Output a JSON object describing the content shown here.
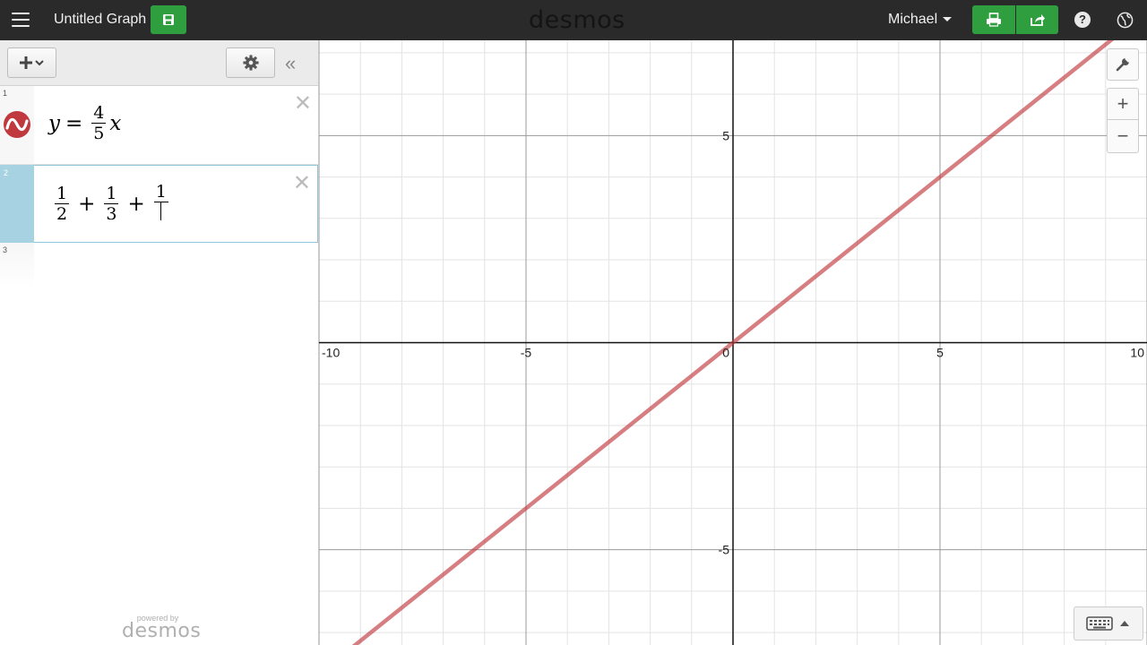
{
  "topbar": {
    "title": "Untitled Graph",
    "logo": "desmos",
    "user": "Michael",
    "help_label": "?",
    "icons": [
      "menu-icon",
      "save-icon",
      "print-icon",
      "share-icon",
      "help-icon",
      "globe-icon"
    ]
  },
  "panel": {
    "collapse_label": "«",
    "expressions": [
      {
        "index": "1",
        "latex": "y=\\frac{4}{5}x",
        "lhs": "y",
        "eq": "=",
        "num": "4",
        "den": "5",
        "var": "x",
        "color": "#c0393f"
      },
      {
        "index": "2",
        "latex": "\\frac{1}{2}+\\frac{1}{3}+\\frac{1}{}",
        "terms": [
          {
            "num": "1",
            "den": "2"
          },
          {
            "num": "1",
            "den": "3"
          },
          {
            "num": "1",
            "den": ""
          }
        ],
        "plus": "+"
      },
      {
        "index": "3"
      }
    ],
    "powered_by": "powered by",
    "powered_brand": "desmos"
  },
  "graph": {
    "zoom_in_label": "+",
    "zoom_out_label": "−",
    "x_ticks": [
      "-10",
      "-5",
      "0",
      "5",
      "10"
    ],
    "y_ticks": [
      "5",
      "-5"
    ],
    "line_color": "#c0393f",
    "slope": 0.8,
    "x_range": [
      -10,
      10
    ],
    "y_range": [
      -7.3,
      7.3
    ]
  }
}
